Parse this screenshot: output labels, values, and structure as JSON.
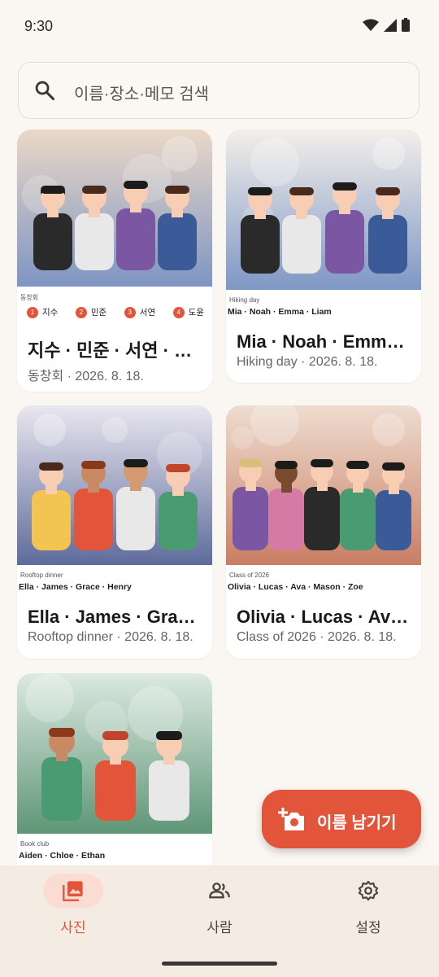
{
  "status": {
    "time": "9:30"
  },
  "search": {
    "placeholder": "이름·장소·메모 검색"
  },
  "cards": [
    {
      "caption": "동창회",
      "chips": [
        {
          "num": "1",
          "name": "지수"
        },
        {
          "num": "2",
          "name": "민준"
        },
        {
          "num": "3",
          "name": "서연"
        },
        {
          "num": "4",
          "name": "도윤"
        }
      ],
      "title": "지수 · 민준 · 서연 · 도윤",
      "subtitle": "동창회 · 2026. 8. 18."
    },
    {
      "caption": "Hiking day",
      "names": "Mia · Noah · Emma · Liam",
      "title": "Mia · Noah · Emma · Liam",
      "subtitle": "Hiking day · 2026. 8. 18."
    },
    {
      "caption": "Rooftop dinner",
      "names": "Ella · James · Grace · Henry",
      "title": "Ella · James · Grace · Henry",
      "subtitle": "Rooftop dinner · 2026. 8. 18."
    },
    {
      "caption": "Class of 2026",
      "names": "Olivia · Lucas · Ava · Mason · Zoe",
      "title": "Olivia · Lucas · Ava · Mason · Zoe",
      "subtitle": "Class of 2026 · 2026. 8. 18."
    },
    {
      "caption": "Book club",
      "names": "Aiden · Chloe · Ethan"
    }
  ],
  "fab": {
    "label": "이름 남기기",
    "icon": "add-photo-icon"
  },
  "nav": [
    {
      "label": "사진",
      "icon": "photos-icon",
      "active": true
    },
    {
      "label": "사람",
      "icon": "people-icon",
      "active": false
    },
    {
      "label": "설정",
      "icon": "gear-icon",
      "active": false
    }
  ],
  "colors": {
    "accent": "#E3553A",
    "background": "#FAF6F1",
    "nav_background": "#F4EBE2"
  }
}
